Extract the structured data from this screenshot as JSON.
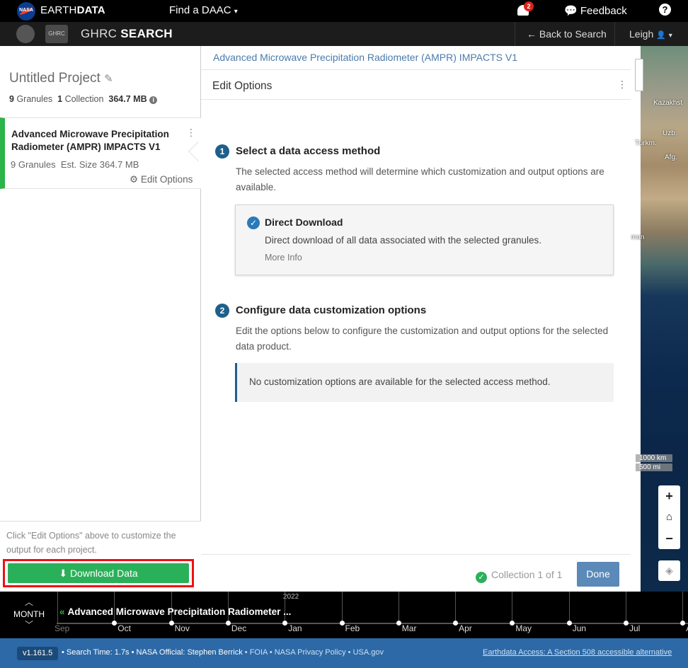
{
  "topbar": {
    "nasa_logo_text": "NASA",
    "brand_earth": "EARTH",
    "brand_data": "DATA",
    "find_daac": "Find a DAAC",
    "find_daac_caret": "▾",
    "notification_count": "2",
    "feedback": "Feedback",
    "help": "?"
  },
  "subbar": {
    "ghrc_logo_text": "GHRC",
    "title_prefix": "GHRC",
    "title_bold": "SEARCH",
    "back_to_search": "Back to Search",
    "back_icon": "←",
    "user": "Leigh",
    "user_icon": "👤",
    "user_caret": "▾"
  },
  "project": {
    "title": "Untitled Project",
    "edit_icon": "✎",
    "granules_count": "9",
    "granules_label": "Granules",
    "collection_count": "1",
    "collection_label": "Collection",
    "size": "364.7 MB",
    "info_icon": "i"
  },
  "collection_card": {
    "title": "Advanced Microwave Precipitation Radiometer (AMPR) IMPACTS V1",
    "kebab": "⋮",
    "granules": "9 Granules",
    "est_size": "Est. Size 364.7 MB",
    "edit_options": "Edit Options",
    "gear_icon": "⚙"
  },
  "left_footer": {
    "hint": "Click \"Edit Options\" above to customize the output for each project.",
    "download_label": "Download Data",
    "download_icon": "⬇"
  },
  "main": {
    "collection_header": "Advanced Microwave Precipitation Radiometer (AMPR) IMPACTS V1",
    "edit_options_title": "Edit Options",
    "kebab": "⋮",
    "step1": {
      "number": "1",
      "title": "Select a data access method",
      "desc": "The selected access method will determine which customization and output options are available."
    },
    "access_method": {
      "check": "✓",
      "title": "Direct Download",
      "desc": "Direct download of all data associated with the selected granules.",
      "more_info": "More Info"
    },
    "step2": {
      "number": "2",
      "title": "Configure data customization options",
      "desc": "Edit the options below to configure the customization and output options for the selected data product."
    },
    "no_custom": "No customization options are available for the selected access method.",
    "footer": {
      "check": "✓",
      "collection_status": "Collection 1 of 1",
      "done": "Done"
    }
  },
  "map": {
    "labels": [
      "Kazakhst",
      "Uzb.",
      "Turkm.",
      "Afg.",
      "man"
    ],
    "scale_km": "1000 km",
    "scale_mi": "500 mi",
    "zoom_in": "+",
    "home": "⌂",
    "zoom_out": "−",
    "layers_icon": "◈"
  },
  "timeline": {
    "month_label": "MONTH",
    "chev_up": "︿",
    "chev_down": "﹀",
    "year": "2022",
    "title": "Advanced Microwave Precipitation Radiometer ...",
    "title_icon": "«",
    "months": [
      "Sep",
      "Oct",
      "Nov",
      "Dec",
      "Jan",
      "Feb",
      "Mar",
      "Apr",
      "May",
      "Jun",
      "Jul",
      "A"
    ]
  },
  "statusbar": {
    "version": "v1.161.5",
    "search_time": "• Search Time: 1.7s",
    "nasa_official": "• NASA Official: Stephen Berrick",
    "foia": "• FOIA",
    "privacy": "• NASA Privacy Policy",
    "usagov": "• USA.gov",
    "accessible_alt": "Earthdata Access: A Section 508 accessible alternative"
  }
}
